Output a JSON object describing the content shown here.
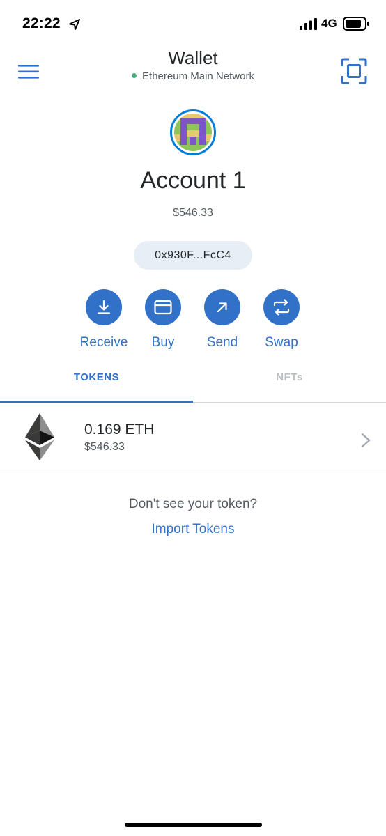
{
  "status_bar": {
    "time": "22:22",
    "network": "4G",
    "icons": [
      "location-arrow-icon",
      "signal-bars-icon",
      "battery-icon"
    ]
  },
  "header": {
    "title": "Wallet",
    "network_name": "Ethereum Main Network",
    "network_status_color": "#3fb17b",
    "icons": [
      "hamburger-menu-icon",
      "qr-scan-icon"
    ]
  },
  "account": {
    "name": "Account 1",
    "balance": "$546.33",
    "address": "0x930F...FcC4"
  },
  "actions": [
    {
      "label": "Receive",
      "icon": "download-arrow-icon"
    },
    {
      "label": "Buy",
      "icon": "credit-card-icon"
    },
    {
      "label": "Send",
      "icon": "arrow-up-right-icon"
    },
    {
      "label": "Swap",
      "icon": "swap-arrows-icon"
    }
  ],
  "tabs": [
    {
      "label": "TOKENS",
      "active": true
    },
    {
      "label": "NFTs",
      "active": false
    }
  ],
  "tokens": [
    {
      "amount": "0.169 ETH",
      "fiat": "$546.33",
      "icon": "ethereum-icon"
    }
  ],
  "footer": {
    "prompt": "Don't see your token?",
    "import_link": "Import Tokens"
  },
  "colors": {
    "accent": "#3271c8",
    "text_primary": "#24272a",
    "text_secondary": "#535a61",
    "address_pill_bg": "#e7eef6"
  }
}
